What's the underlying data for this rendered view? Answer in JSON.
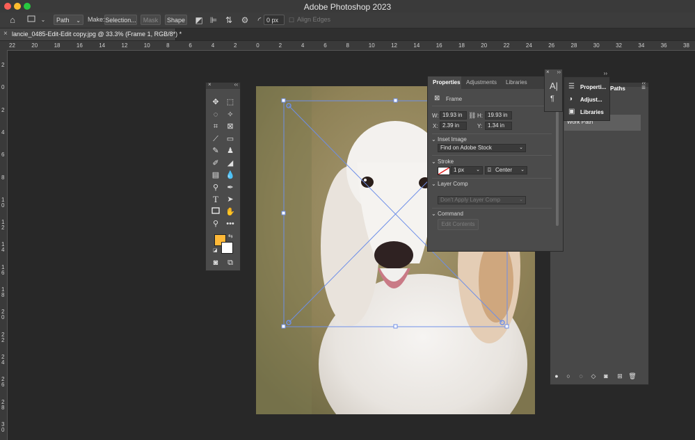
{
  "window": {
    "title": "Adobe Photoshop 2023"
  },
  "options_bar": {
    "mode_value": "Path",
    "make_label": "Make:",
    "selection_button": "Selection...",
    "mask_button": "Mask",
    "shape_button": "Shape",
    "radius_value": "0 px",
    "align_edges_label": "Align Edges"
  },
  "document": {
    "tab_title": "lancie_0485-Edit-Edit copy.jpg @ 33.3% (Frame 1, RGB/8*) *"
  },
  "rulers": {
    "horizontal": [
      "22",
      "20",
      "18",
      "16",
      "14",
      "12",
      "10",
      "8",
      "6",
      "4",
      "2",
      "0",
      "2",
      "4",
      "6",
      "8",
      "10",
      "12",
      "14",
      "16",
      "18",
      "20",
      "22",
      "24",
      "26",
      "28",
      "30",
      "32",
      "34",
      "36",
      "38"
    ],
    "vertical": [
      "2",
      "0",
      "2",
      "4",
      "6",
      "8",
      "1 0",
      "1 2",
      "1 4",
      "1 6",
      "1 8",
      "2 0",
      "2 2",
      "2 4",
      "2 6",
      "2 8",
      "3 0"
    ]
  },
  "colors": {
    "foreground": "#ffb938",
    "background": "#ffffff",
    "frame_outline": "#6e8fe8"
  },
  "properties": {
    "tabs": [
      "Properties",
      "Adjustments",
      "Libraries"
    ],
    "object_type": "Frame",
    "w_label": "W:",
    "w_value": "19.93 in",
    "h_label": "H:",
    "h_value": "19.93 in",
    "x_label": "X:",
    "x_value": "2.39 in",
    "y_label": "Y:",
    "y_value": "1.34 in",
    "inset_image_section": "Inset Image",
    "inset_image_value": "Find on Adobe Stock",
    "stroke_section": "Stroke",
    "stroke_width": "1 px",
    "stroke_align": "Center",
    "layer_comp_section": "Layer Comp",
    "layer_comp_value": "Don't Apply Layer Comp",
    "command_section": "Command",
    "edit_contents_button": "Edit Contents"
  },
  "paths_panel": {
    "tab": "Paths",
    "item": "Work Path"
  },
  "popup_menu": {
    "items": [
      "Properti...",
      "Adjust...",
      "Libraries"
    ]
  }
}
